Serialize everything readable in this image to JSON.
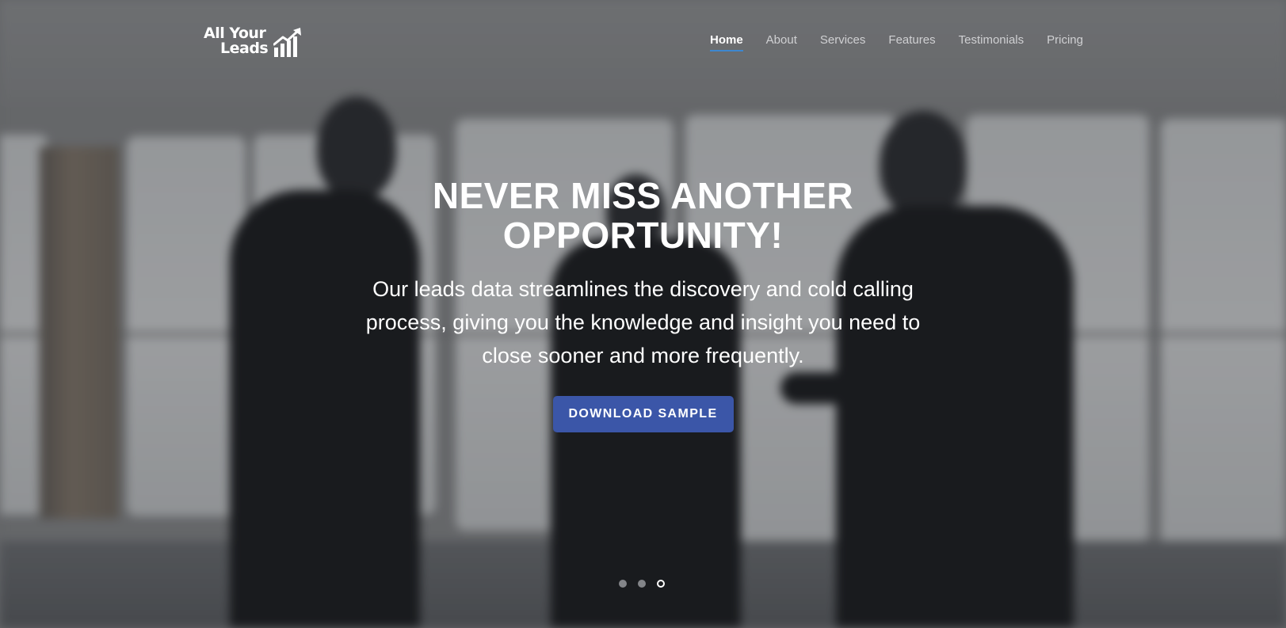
{
  "brand": {
    "line1": "All Your",
    "line2": "Leads",
    "icon": "rising-bar-chart-arrow-icon"
  },
  "nav": {
    "items": [
      {
        "label": "Home",
        "active": true
      },
      {
        "label": "About",
        "active": false
      },
      {
        "label": "Services",
        "active": false
      },
      {
        "label": "Features",
        "active": false
      },
      {
        "label": "Testimonials",
        "active": false
      },
      {
        "label": "Pricing",
        "active": false
      }
    ]
  },
  "hero": {
    "headline_line1": "NEVER MISS ANOTHER",
    "headline_line2": "OPPORTUNITY!",
    "subtext": "Our leads data streamlines the discovery and cold calling process, giving you the knowledge and insight you need to close sooner and more frequently.",
    "cta_label": "DOWNLOAD SAMPLE"
  },
  "carousel": {
    "slide_count": 3,
    "active_slide": 3
  },
  "colors": {
    "accent": "#3b56a8",
    "nav_underline": "#3d87cf",
    "text": "#ffffff"
  }
}
